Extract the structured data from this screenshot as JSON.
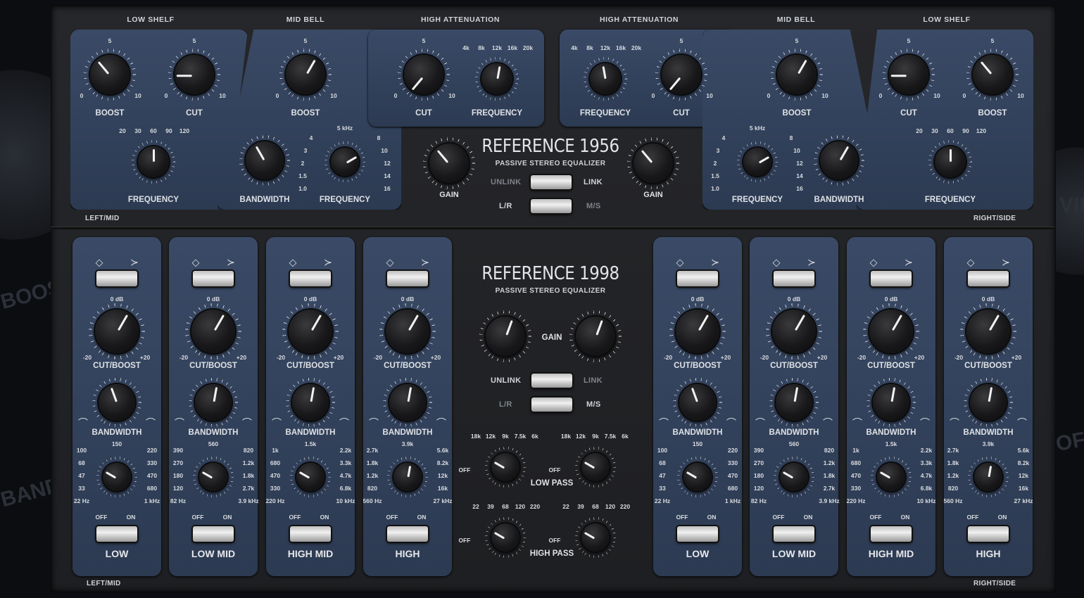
{
  "background_ghost": {
    "boost": "BOOST",
    "bandw": "BANDW",
    "off": "OFF",
    "vid": "VID"
  },
  "top": {
    "section_labels": [
      "LOW SHELF",
      "MID BELL",
      "HIGH ATTENUATION",
      "HIGH ATTENUATION",
      "MID BELL",
      "LOW SHELF"
    ],
    "title": "REFERENCE 1956",
    "subtitle": "PASSIVE STEREO EQUALIZER",
    "unlink": "UNLINK",
    "link": "LINK",
    "lr": "L/R",
    "ms": "M/S",
    "gain": "GAIN",
    "left_mid": "LEFT/MID",
    "right_side": "RIGHT/SIDE",
    "boost": "BOOST",
    "cut": "CUT",
    "frequency": "FREQUENCY",
    "bandwidth": "BANDWIDTH",
    "n0": "0",
    "n5": "5",
    "n10": "10",
    "shelf_freqs": [
      "20",
      "30",
      "60",
      "90",
      "120"
    ],
    "hi_att_freqs": [
      "4k",
      "8k",
      "12k",
      "16k",
      "20k"
    ],
    "bell_left": [
      "1.0",
      "1.5",
      "2",
      "3",
      "4"
    ],
    "bell_top": "5 kHz",
    "bell_right": [
      "8",
      "10",
      "12",
      "14",
      "16"
    ]
  },
  "bottom": {
    "title": "REFERENCE 1998",
    "subtitle": "PASSIVE STEREO EQUALIZER",
    "gain": "GAIN",
    "unlink": "UNLINK",
    "link": "LINK",
    "lr": "L/R",
    "ms": "M/S",
    "left_mid": "LEFT/MID",
    "right_side": "RIGHT/SIDE",
    "zero_db": "0 dB",
    "minus20": "-20",
    "plus20": "+20",
    "cut_boost": "CUT/BOOST",
    "bandwidth": "BANDWIDTH",
    "off": "OFF",
    "on": "ON",
    "low_pass": "LOW PASS",
    "high_pass": "HIGH PASS",
    "lp_freqs": [
      "18k",
      "12k",
      "9k",
      "7.5k",
      "6k"
    ],
    "hp_freqs": [
      "22",
      "39",
      "68",
      "120",
      "220"
    ],
    "bands": [
      {
        "name": "LOW",
        "top": "150",
        "left": [
          "100",
          "68",
          "47",
          "33",
          "22 Hz"
        ],
        "right": [
          "220",
          "330",
          "470",
          "680",
          "1 kHz"
        ]
      },
      {
        "name": "LOW MID",
        "top": "560",
        "left": [
          "390",
          "270",
          "180",
          "120",
          "82 Hz"
        ],
        "right": [
          "820",
          "1.2k",
          "1.8k",
          "2.7k",
          "3.9 kHz"
        ]
      },
      {
        "name": "HIGH MID",
        "top": "1.5k",
        "left": [
          "1k",
          "680",
          "470",
          "330",
          "220 Hz"
        ],
        "right": [
          "2.2k",
          "3.3k",
          "4.7k",
          "6.8k",
          "10 kHz"
        ]
      },
      {
        "name": "HIGH",
        "top": "3.9k",
        "left": [
          "2.7k",
          "1.8k",
          "1.2k",
          "820",
          "560 Hz"
        ],
        "right": [
          "5.6k",
          "8.2k",
          "12k",
          "16k",
          "27 kHz"
        ]
      }
    ]
  }
}
